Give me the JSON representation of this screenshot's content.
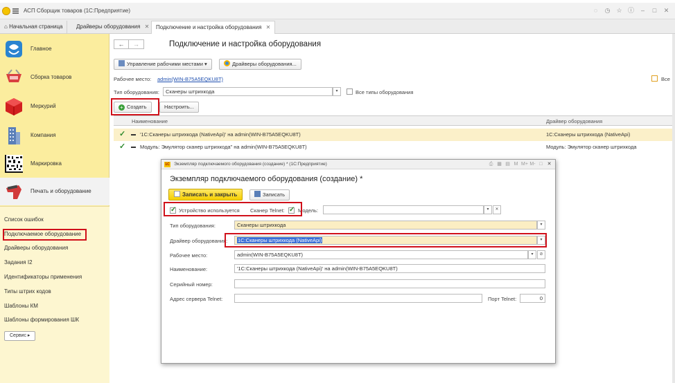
{
  "window": {
    "title": "АСП Сборщик товаров  (1С:Предприятие)"
  },
  "tabs": [
    {
      "label": "Начальная страница"
    },
    {
      "label": "Драйверы оборудования"
    },
    {
      "label": "Подключение и настройка оборудования"
    }
  ],
  "sidebar": {
    "items": [
      {
        "label": "Главное"
      },
      {
        "label": "Сборка товаров"
      },
      {
        "label": "Меркурий"
      },
      {
        "label": "Компания"
      },
      {
        "label": "Маркировка"
      },
      {
        "label": "Печать и оборудование"
      }
    ],
    "links": [
      {
        "label": "Список ошибок"
      },
      {
        "label": "Подключаемое оборудование"
      },
      {
        "label": "Драйверы оборудования"
      },
      {
        "label": "Задания I2"
      },
      {
        "label": "Идентификаторы применения"
      },
      {
        "label": "Типы штрих кодов"
      },
      {
        "label": "Шаблоны КМ"
      },
      {
        "label": "Шаблоны формирования ШК"
      }
    ],
    "service_label": "Сервис ▸"
  },
  "page": {
    "title": "Подключение и настройка оборудования",
    "manage_workplaces": "Управление рабочими местами ▾",
    "drivers_button": "Драйверы оборудования...",
    "workplace_label": "Рабочее место:",
    "workplace_value": "admin(WIN-B75A5EQKU8T)",
    "equipment_type_label": "Тип оборудования:",
    "equipment_type_value": "Сканеры штрихкода",
    "all_types_label": "Все типы оборудования",
    "all_label": "Все",
    "create_button": "Создать",
    "configure_button": "Настроить...",
    "table": {
      "headers": [
        "Наименование",
        "Драйвер оборудования"
      ],
      "rows": [
        {
          "name": "'1С:Сканеры штрихкода (NativeApi)' на admin(WIN-B75A5EQKU8T)",
          "driver": "1С:Сканеры штрихкода (NativeApi)"
        },
        {
          "name": "Модуль: Эмулятор сканер штрихкода\" на admin(WIN-B75A5EQKU8T)",
          "driver": "Модуль: Эмулятор сканер штрихкода"
        }
      ]
    }
  },
  "dialog": {
    "window_title": "Экземпляр подключаемого оборудования (создание) * (1С:Предприятие)",
    "title": "Экземпляр подключаемого оборудования (создание) *",
    "save_close": "Записать и закрыть",
    "save": "Записать",
    "device_used": "Устройство используется",
    "scanner_telnet": "Сканер Telnet:",
    "model_label": "Модель:",
    "equipment_type_label": "Тип оборудования:",
    "equipment_type_value": "Сканеры штрихкода",
    "driver_label": "Драйвер оборудования:",
    "driver_value": "1С:Сканеры штрихкода (NativeApi)",
    "workplace_label": "Рабочее место:",
    "workplace_value": "admin(WIN-B75A5EQKU8T)",
    "name_label": "Наименование:",
    "name_value": "'1С:Сканеры штрихкода (NativeApi)' на admin(WIN-B75A5EQKU8T)",
    "serial_label": "Серийный номер:",
    "telnet_address_label": "Адрес сервера Telnet:",
    "telnet_port_label": "Порт Telnet:",
    "telnet_port_value": "0"
  },
  "colors": {
    "sidebar_bg": "#fbed9e",
    "highlight": "#d0101a",
    "accent_yellow": "#f5cf00",
    "link": "#2050b0"
  }
}
